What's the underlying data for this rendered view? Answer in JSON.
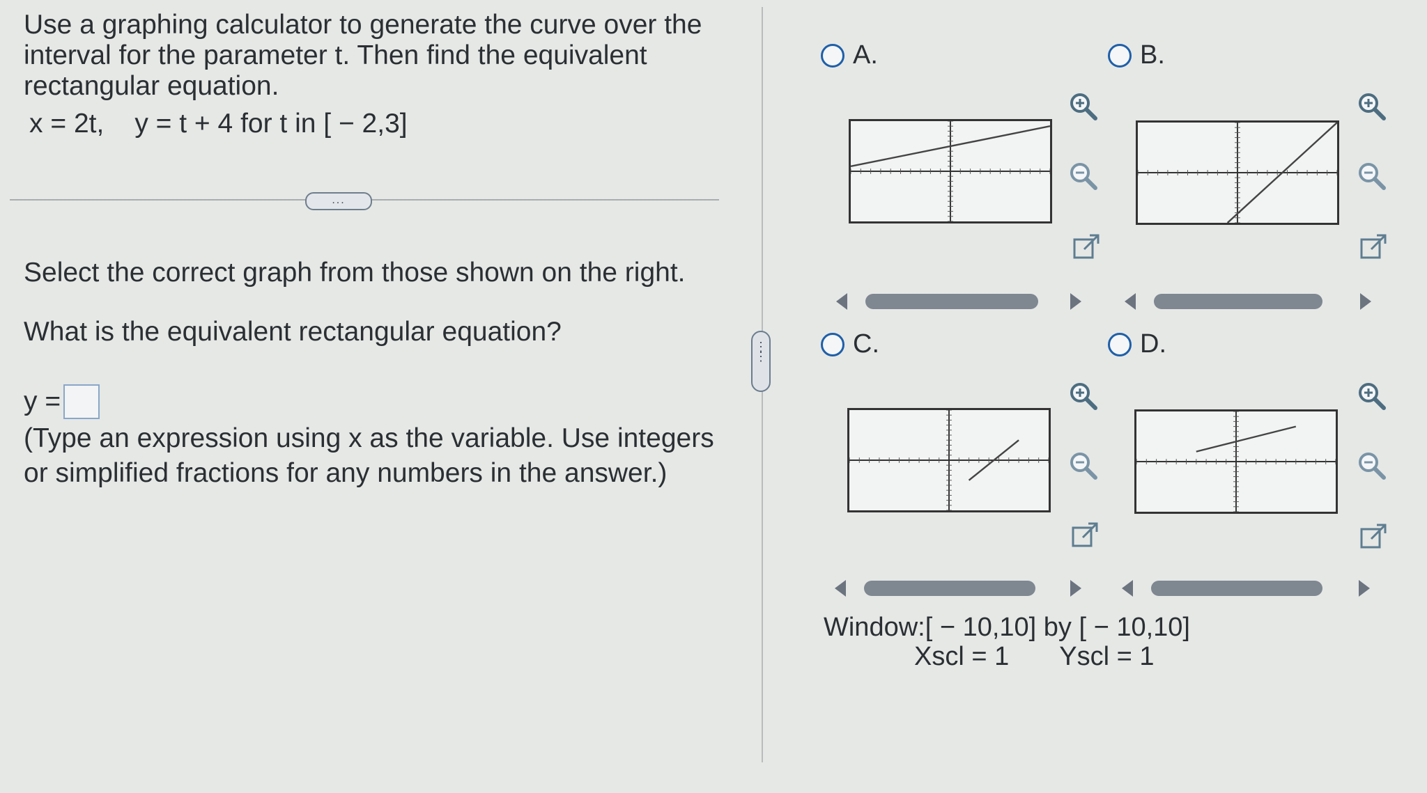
{
  "question": {
    "line1": "Use a graphing calculator to generate the curve over the",
    "line2": "interval for the parameter t. Then find the equivalent",
    "line3": "rectangular equation.",
    "eq_x": "x = 2t,",
    "eq_y": "y = t + 4 for t in [ − 2,3]"
  },
  "more_button": "...",
  "instruction": "Select the correct graph from those shown on the right.",
  "prompt": "What is the equivalent rectangular equation?",
  "answer": {
    "label": "y =",
    "value": "",
    "hint_line1": "(Type an expression using x as the variable. Use integers",
    "hint_line2": "or simplified fractions for any numbers in the answer.)"
  },
  "options": [
    {
      "letter": "A.",
      "selected": false
    },
    {
      "letter": "B.",
      "selected": false
    },
    {
      "letter": "C.",
      "selected": false
    },
    {
      "letter": "D.",
      "selected": false
    }
  ],
  "icons": {
    "zoom_in": "zoom-in-icon",
    "zoom_out": "zoom-out-icon",
    "popout": "popout-icon"
  },
  "window": {
    "line1": "Window:[ − 10,10] by [ − 10,10]",
    "xscl": "Xscl = 1",
    "yscl": "Yscl = 1"
  },
  "chart_data": [
    {
      "type": "line",
      "option": "A",
      "xlim": [
        -10,
        10
      ],
      "ylim": [
        -10,
        10
      ],
      "series": [
        {
          "x": [
            -10,
            10
          ],
          "y": [
            1,
            9
          ]
        }
      ]
    },
    {
      "type": "line",
      "option": "B",
      "xlim": [
        -10,
        10
      ],
      "ylim": [
        -10,
        10
      ],
      "series": [
        {
          "x": [
            -1,
            10
          ],
          "y": [
            -10,
            10
          ]
        }
      ]
    },
    {
      "type": "line",
      "option": "C",
      "xlim": [
        -10,
        10
      ],
      "ylim": [
        -10,
        10
      ],
      "series": [
        {
          "x": [
            2,
            7
          ],
          "y": [
            -4,
            4
          ]
        }
      ]
    },
    {
      "type": "line",
      "option": "D",
      "xlim": [
        -10,
        10
      ],
      "ylim": [
        -10,
        10
      ],
      "series": [
        {
          "x": [
            -4,
            6
          ],
          "y": [
            2,
            7
          ]
        }
      ]
    }
  ]
}
